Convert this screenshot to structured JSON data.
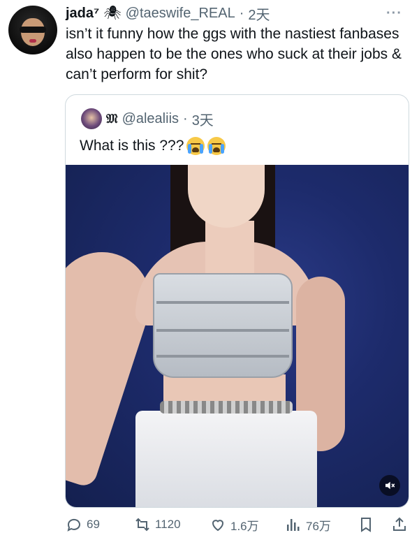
{
  "tweet": {
    "author_name": "jada⁷",
    "handle": "@taeswife_REAL",
    "separator": "·",
    "time": "2天",
    "text": "isn’t it funny how the ggs with the nastiest fanbases also happen to be the ones who suck at their jobs & can’t perform for shit?",
    "more": "···"
  },
  "quote": {
    "mark": "𝔐",
    "handle": "@alealiis",
    "separator": "·",
    "time": "3天",
    "text": "What is this ???"
  },
  "actions": {
    "replies": "69",
    "retweets": "1120",
    "likes": "1.6万",
    "views": "76万"
  },
  "icons": {
    "spider": "spider-icon",
    "mute": "mute-icon",
    "reply": "reply-icon",
    "retweet": "retweet-icon",
    "like": "heart-icon",
    "views": "views-icon",
    "bookmark": "bookmark-icon",
    "share": "share-icon"
  },
  "colors": {
    "text": "#0f1419",
    "secondary": "#536471",
    "border": "#cfd9de",
    "media_bg": "#1d2b6c"
  }
}
